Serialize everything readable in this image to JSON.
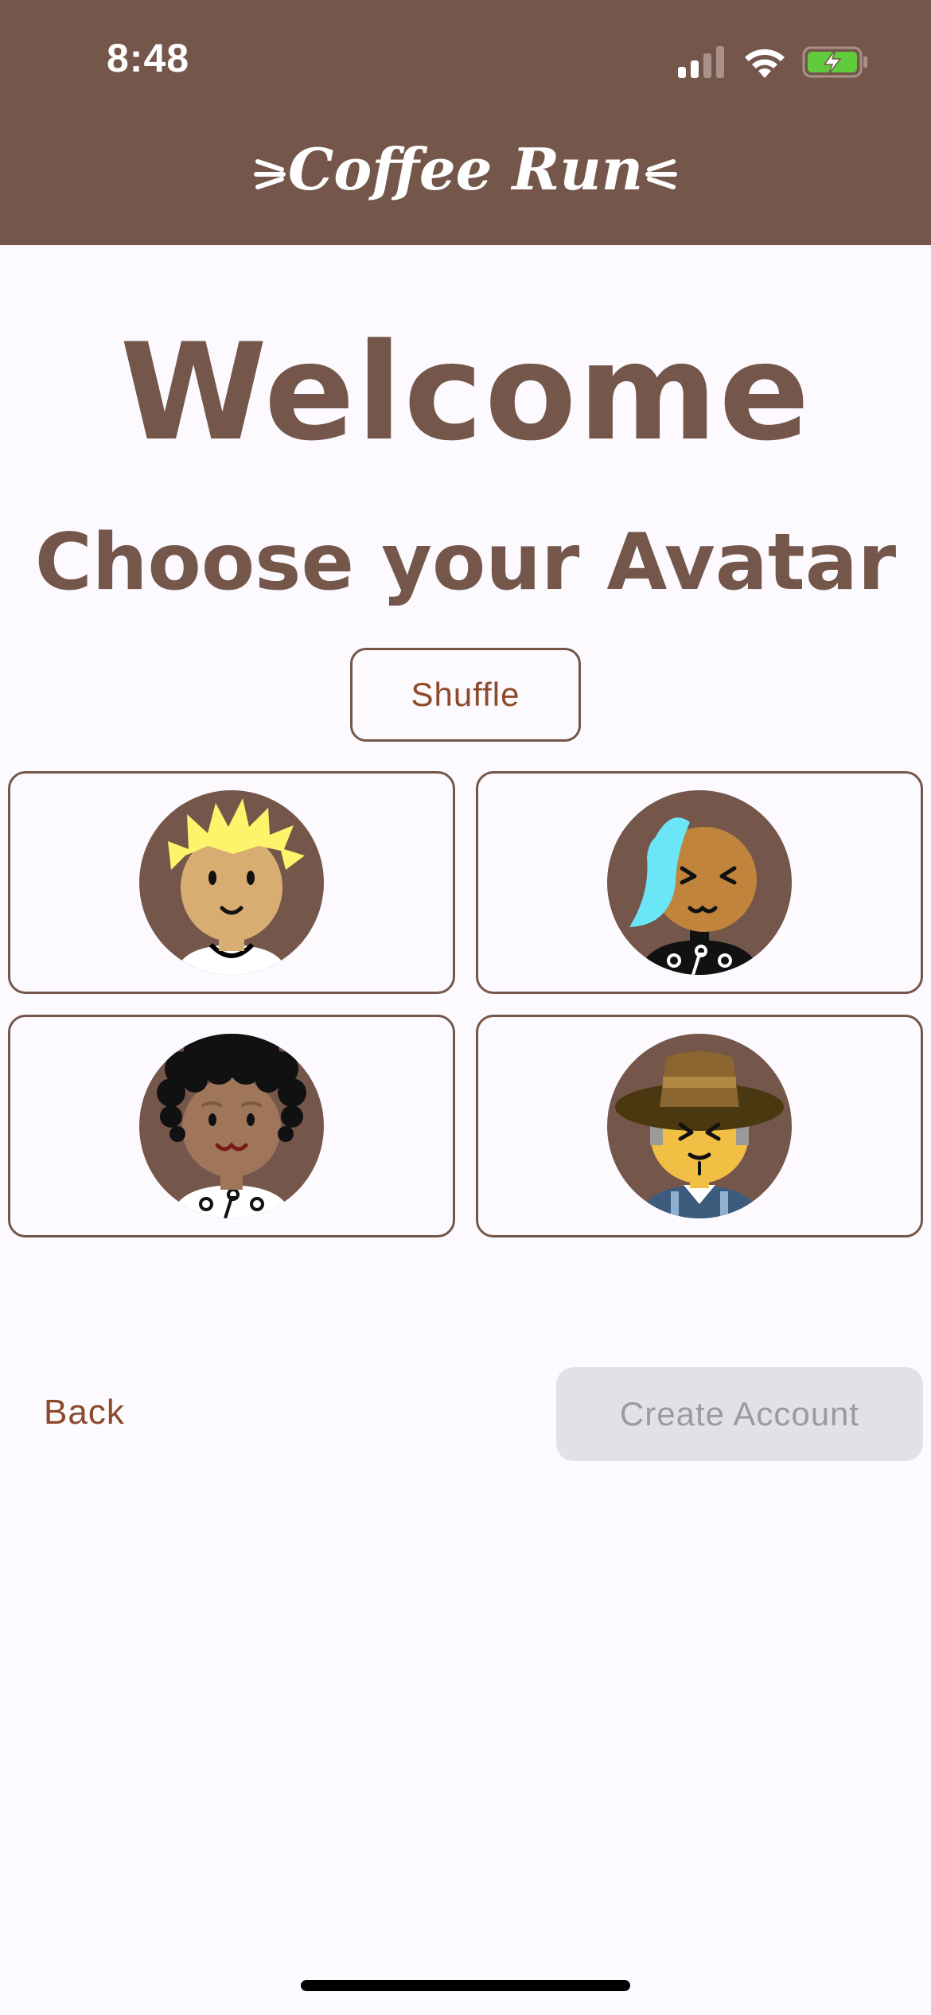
{
  "status_bar": {
    "time": "8:48"
  },
  "header": {
    "app_title": "Coffee Run",
    "background_color": "#74574a"
  },
  "main": {
    "heading": "Welcome",
    "subheading": "Choose your Avatar",
    "shuffle_label": "Shuffle",
    "avatars": [
      {
        "name": "spiky-blonde-hair-avatar",
        "icon": "person-yellow-spiky-hair"
      },
      {
        "name": "blue-ponytail-avatar",
        "icon": "person-blue-ponytail"
      },
      {
        "name": "curly-black-hair-avatar",
        "icon": "person-curly-black-hair"
      },
      {
        "name": "brown-hat-avatar",
        "icon": "person-brown-hat"
      }
    ]
  },
  "footer": {
    "back_label": "Back",
    "create_account_label": "Create Account"
  },
  "colors": {
    "brand": "#74574a",
    "link": "#8c4a2a",
    "disabled_bg": "#e3e1e6",
    "disabled_text": "#9c9a9f",
    "page_bg": "#fcfaff"
  }
}
